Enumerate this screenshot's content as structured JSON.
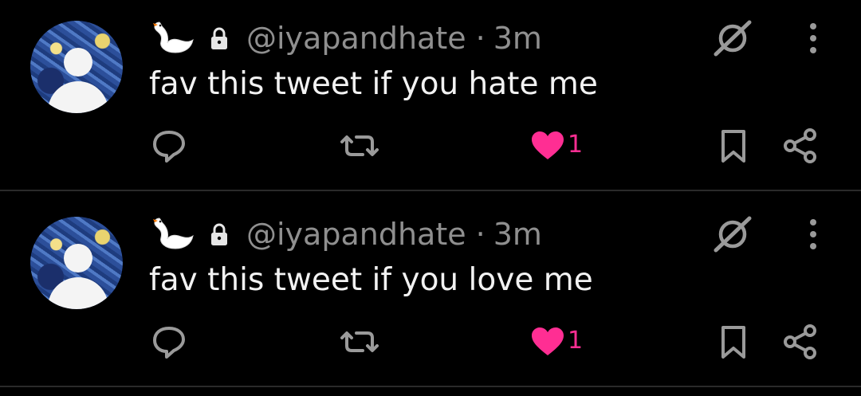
{
  "tweets": [
    {
      "emoji": "🦢",
      "handle": "@iyapandhate",
      "separator": "·",
      "time": "3m",
      "text": "fav this tweet if you hate me",
      "like_count": "1",
      "liked": true
    },
    {
      "emoji": "🦢",
      "handle": "@iyapandhate",
      "separator": "·",
      "time": "3m",
      "text": "fav this tweet if you love me",
      "like_count": "1",
      "liked": true
    }
  ],
  "icons": {
    "protected": "lock-icon",
    "caret": "slashed-circle-icon",
    "more": "vertical-ellipsis-icon",
    "reply": "reply-bubble-icon",
    "retweet": "retweet-icon",
    "like": "heart-icon",
    "bookmark": "bookmark-icon",
    "share": "share-icon"
  },
  "colors": {
    "background": "#000000",
    "text": "#f2f2f2",
    "muted": "#8f8f8f",
    "like": "#ff2e93",
    "divider": "#2a2a2a"
  }
}
